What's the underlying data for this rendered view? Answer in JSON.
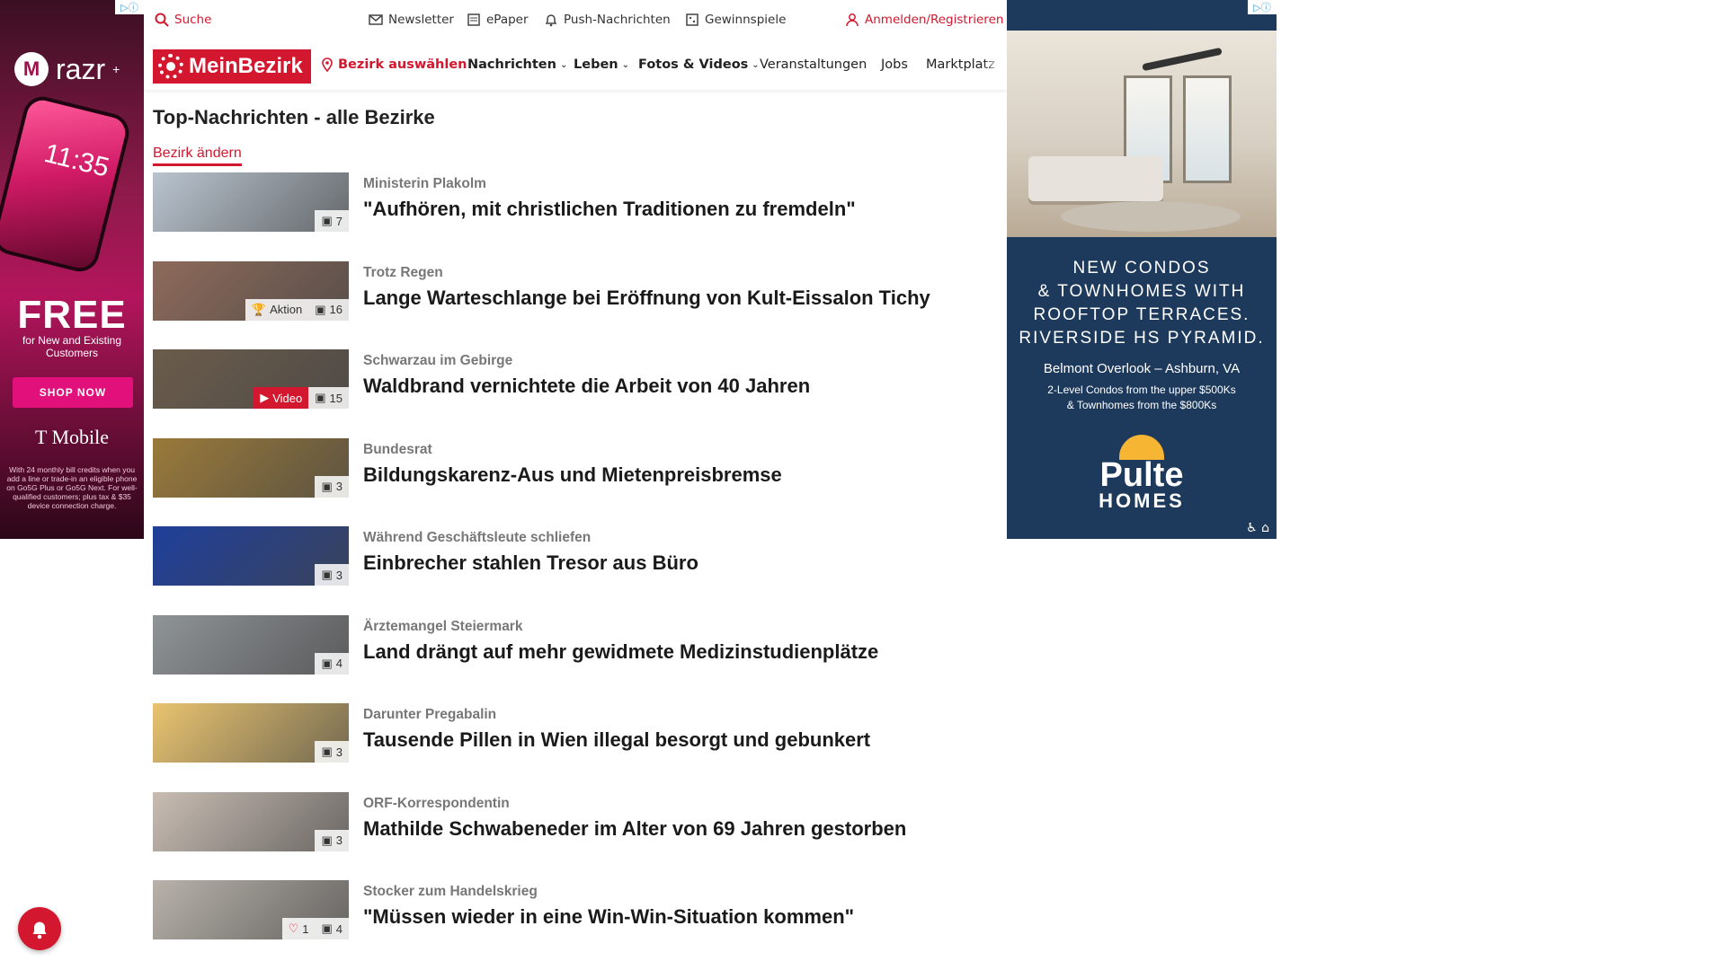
{
  "ads": {
    "left": {
      "brand": "razr",
      "phone_time": "11:35",
      "free": "FREE",
      "free_sub": "for New and Existing Customers",
      "cta": "SHOP NOW",
      "advertiser": "T Mobile",
      "fineprint": "With 24 monthly bill credits when you add a line or trade-in an eligible phone on Go5G Plus or Go5G Next. For well-qualified customers; plus tax & $35 device connection charge."
    },
    "right": {
      "headline_lines": [
        "NEW CONDOS",
        "& TOWNHOMES WITH",
        "ROOFTOP TERRACES.",
        "RIVERSIDE HS PYRAMID."
      ],
      "location": "Belmont Overlook – Ashburn, VA",
      "price_line1": "2-Level Condos from the upper $500Ks",
      "price_line2": "& Townhomes from the $800Ks",
      "brand": "Pulte",
      "brand_sub": "HOMES"
    }
  },
  "topbar": {
    "search": "Suche",
    "newsletter": "Newsletter",
    "epaper": "ePaper",
    "push": "Push-Nachrichten",
    "games": "Gewinnspiele",
    "login": "Anmelden/Registrieren"
  },
  "nav": {
    "logo": "MeinBezirk",
    "select_district": "Bezirk auswählen",
    "items": [
      "Nachrichten",
      "Leben",
      "Fotos & Videos",
      "Veranstaltungen",
      "Jobs",
      "Marktplatz"
    ]
  },
  "page": {
    "title": "Top-Nachrichten - alle Bezirke",
    "change_district": "Bezirk ändern"
  },
  "articles": [
    {
      "kicker": "Ministerin Plakolm",
      "headline": "\"Aufhören, mit christlichen Traditionen zu fremdeln\"",
      "photos": "7",
      "thumb_color": "#b9c4cf"
    },
    {
      "kicker": "Trotz Regen",
      "headline": "Lange Warteschlange bei Eröffnung von Kult-Eissalon Tichy",
      "photos": "16",
      "extra": "Aktion",
      "thumb_color": "#8d6a5a"
    },
    {
      "kicker": "Schwarzau im Gebirge",
      "headline": "Waldbrand vernichtete die Arbeit von 40 Jahren",
      "photos": "15",
      "video": "Video",
      "thumb_color": "#6b5c4c"
    },
    {
      "kicker": "Bundesrat",
      "headline": "Bildungskarenz-Aus und Mietenpreisbremse",
      "photos": "3",
      "thumb_color": "#9a7a3a"
    },
    {
      "kicker": "Während Geschäftsleute schliefen",
      "headline": "Einbrecher stahlen Tresor aus Büro",
      "photos": "3",
      "thumb_color": "#1f3f9a"
    },
    {
      "kicker": "Ärztemangel Steiermark",
      "headline": "Land drängt auf mehr gewidmete Medizinstudienplätze",
      "photos": "4",
      "thumb_color": "#8f9497"
    },
    {
      "kicker": "Darunter Pregabalin",
      "headline": "Tausende Pillen in Wien illegal besorgt und gebunkert",
      "photos": "3",
      "thumb_color": "#e9c470"
    },
    {
      "kicker": "ORF-Korrespondentin",
      "headline": "Mathilde Schwabeneder im Alter von 69 Jahren gestorben",
      "photos": "3",
      "thumb_color": "#c9bdb3"
    },
    {
      "kicker": "Stocker zum Handelskrieg",
      "headline": "\"Müssen wieder in eine Win-Win-Situation kommen\"",
      "photos": "4",
      "likes": "1",
      "thumb_color": "#b8b2aa"
    }
  ]
}
